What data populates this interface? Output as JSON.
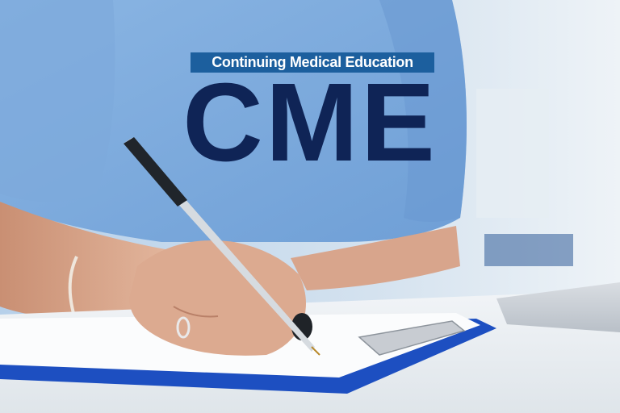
{
  "image": {
    "subtitle_banner": "Continuing Medical Education",
    "headline": "CME"
  },
  "colors": {
    "banner_bg": "#1c5f9e",
    "headline": "#0f2456",
    "scrubs": "#7aa6d6",
    "clipboard": "#1d4fc1"
  }
}
